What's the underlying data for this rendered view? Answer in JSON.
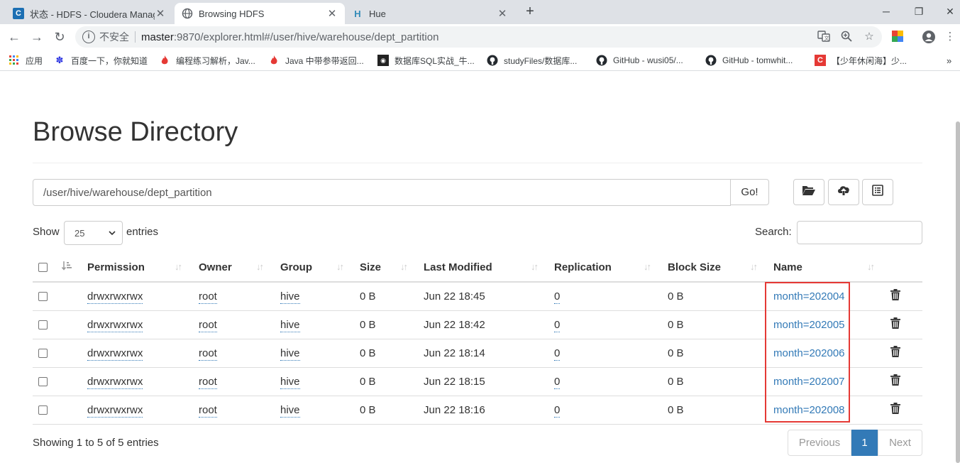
{
  "browser": {
    "tabs": [
      {
        "title": "状态 - HDFS - Cloudera Manag",
        "favicon": "cloudera-icon"
      },
      {
        "title": "Browsing HDFS",
        "favicon": "globe-icon"
      },
      {
        "title": "Hue",
        "favicon": "hue-icon"
      }
    ],
    "omnibox": {
      "security": "不安全",
      "host": "master",
      "rest": ":9870/explorer.html#/user/hive/warehouse/dept_partition"
    },
    "bookmarks": [
      {
        "label": "应用",
        "icon": "apps-icon"
      },
      {
        "label": "百度一下，你就知道",
        "icon": "baidu-icon"
      },
      {
        "label": "编程练习解析，Jav...",
        "icon": "flame-icon"
      },
      {
        "label": "Java 中带参带返回...",
        "icon": "flame-icon"
      },
      {
        "label": "数据库SQL实战_牛...",
        "icon": "nowcoder-icon"
      },
      {
        "label": "studyFiles/数据库...",
        "icon": "github-icon"
      },
      {
        "label": "GitHub - wusi05/...",
        "icon": "github-icon"
      },
      {
        "label": "GitHub - tomwhit...",
        "icon": "github-icon"
      },
      {
        "label": "【少年休闲海】少...",
        "icon": "csdn-icon"
      }
    ]
  },
  "page": {
    "title": "Browse Directory",
    "path_value": "/user/hive/warehouse/dept_partition",
    "go_label": "Go!",
    "show_label": "Show",
    "entries_value": "25",
    "entries_label": "entries",
    "search_label": "Search:",
    "columns": [
      "Permission",
      "Owner",
      "Group",
      "Size",
      "Last Modified",
      "Replication",
      "Block Size",
      "Name"
    ],
    "rows": [
      {
        "permission": "drwxrwxrwx",
        "owner": "root",
        "group": "hive",
        "size": "0 B",
        "modified": "Jun 22 18:45",
        "replication": "0",
        "block_size": "0 B",
        "name": "month=202004"
      },
      {
        "permission": "drwxrwxrwx",
        "owner": "root",
        "group": "hive",
        "size": "0 B",
        "modified": "Jun 22 18:42",
        "replication": "0",
        "block_size": "0 B",
        "name": "month=202005"
      },
      {
        "permission": "drwxrwxrwx",
        "owner": "root",
        "group": "hive",
        "size": "0 B",
        "modified": "Jun 22 18:14",
        "replication": "0",
        "block_size": "0 B",
        "name": "month=202006"
      },
      {
        "permission": "drwxrwxrwx",
        "owner": "root",
        "group": "hive",
        "size": "0 B",
        "modified": "Jun 22 18:15",
        "replication": "0",
        "block_size": "0 B",
        "name": "month=202007"
      },
      {
        "permission": "drwxrwxrwx",
        "owner": "root",
        "group": "hive",
        "size": "0 B",
        "modified": "Jun 22 18:16",
        "replication": "0",
        "block_size": "0 B",
        "name": "month=202008"
      }
    ],
    "info": "Showing 1 to 5 of 5 entries",
    "pagination": {
      "previous": "Previous",
      "current": "1",
      "next": "Next"
    },
    "colors": {
      "link": "#337ab7",
      "highlight": "#e53935",
      "active_page": "#337ab7"
    }
  }
}
